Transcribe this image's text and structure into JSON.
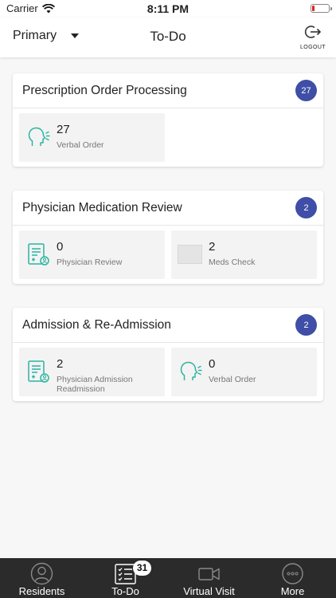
{
  "status_bar": {
    "carrier": "Carrier",
    "time": "8:11 PM"
  },
  "header": {
    "selector_label": "Primary",
    "title": "To-Do",
    "logout_label": "LOGOUT"
  },
  "sections": [
    {
      "title": "Prescription Order Processing",
      "badge": "27",
      "tiles": [
        {
          "count": "27",
          "label": "Verbal Order",
          "icon": "speaking-head-icon"
        }
      ]
    },
    {
      "title": "Physician Medication Review",
      "badge": "2",
      "tiles": [
        {
          "count": "0",
          "label": "Physician Review",
          "icon": "medical-document-icon"
        },
        {
          "count": "2",
          "label": "Meds Check",
          "icon": "image-placeholder-icon"
        }
      ]
    },
    {
      "title": "Admission & Re-Admission",
      "badge": "2",
      "tiles": [
        {
          "count": "2",
          "label": "Physician Admission Readmission",
          "icon": "medical-document-icon"
        },
        {
          "count": "0",
          "label": "Verbal Order",
          "icon": "speaking-head-icon"
        }
      ]
    }
  ],
  "tab_bar": {
    "tabs": [
      {
        "label": "Residents",
        "icon": "person-icon"
      },
      {
        "label": "To-Do",
        "icon": "checklist-icon",
        "badge": "31"
      },
      {
        "label": "Virtual Visit",
        "icon": "video-camera-icon"
      },
      {
        "label": "More",
        "icon": "more-icon"
      }
    ]
  },
  "colors": {
    "accent": "#3f4ea6",
    "icon_teal": "#2bb5a1",
    "tabbar_bg": "#2b2b2b",
    "battery_low": "#e02424"
  }
}
